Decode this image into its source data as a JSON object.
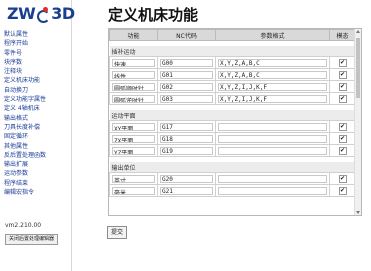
{
  "brand": {
    "logo_left": "ZW",
    "logo_right": "3D"
  },
  "sidebar": {
    "items": [
      {
        "label": "默认属性"
      },
      {
        "label": "程序开始"
      },
      {
        "label": "零件号"
      },
      {
        "label": "块序数"
      },
      {
        "label": "注释块"
      },
      {
        "label": "定义机床功能"
      },
      {
        "label": "自动换刀"
      },
      {
        "label": "定义功能字属性"
      },
      {
        "label": "定义 4轴机床"
      },
      {
        "label": "输出格式"
      },
      {
        "label": "刀具长度补偿"
      },
      {
        "label": "固定循环"
      },
      {
        "label": "其他属性"
      },
      {
        "label": "反后置处理函数"
      },
      {
        "label": "输出扩展"
      },
      {
        "label": "运动参数"
      },
      {
        "label": "程序结束"
      },
      {
        "label": "编辑宏指令"
      }
    ],
    "version": "vm2.210.00",
    "bottom_button": "关闭后置处理编辑器"
  },
  "page": {
    "title": "定义机床功能"
  },
  "table": {
    "columns": [
      "功能",
      "NC代码",
      "参数格式",
      "模态"
    ],
    "sections": [
      {
        "title": "插补运动",
        "rows": [
          {
            "name": "快速",
            "code": "G00",
            "params": "X,Y,Z,A,B,C",
            "modal": "✔"
          },
          {
            "name": "线性",
            "code": "G01",
            "params": "X,Y,Z,A,B,C",
            "modal": "✔"
          },
          {
            "name": "圆弧顺时针",
            "code": "G02",
            "params": "X,Y,Z,I,J,K,F",
            "modal": "✔"
          },
          {
            "name": "圆弧逆时针",
            "code": "G03",
            "params": "X,Y,Z,I,J,K,F",
            "modal": "✔"
          }
        ]
      },
      {
        "title": "运动平面",
        "rows": [
          {
            "name": "XY平面",
            "code": "G17",
            "params": "",
            "modal": "✔"
          },
          {
            "name": "ZX平面",
            "code": "G18",
            "params": "",
            "modal": "✔"
          },
          {
            "name": "YZ平面",
            "code": "G19",
            "params": "",
            "modal": "✔"
          }
        ]
      },
      {
        "title": "输出单位",
        "rows": [
          {
            "name": "英寸",
            "code": "G20",
            "params": "",
            "modal": "✔"
          },
          {
            "name": "毫米",
            "code": "G21",
            "params": "",
            "modal": "✔"
          }
        ]
      }
    ]
  },
  "footer": {
    "submit_label": "提交"
  }
}
